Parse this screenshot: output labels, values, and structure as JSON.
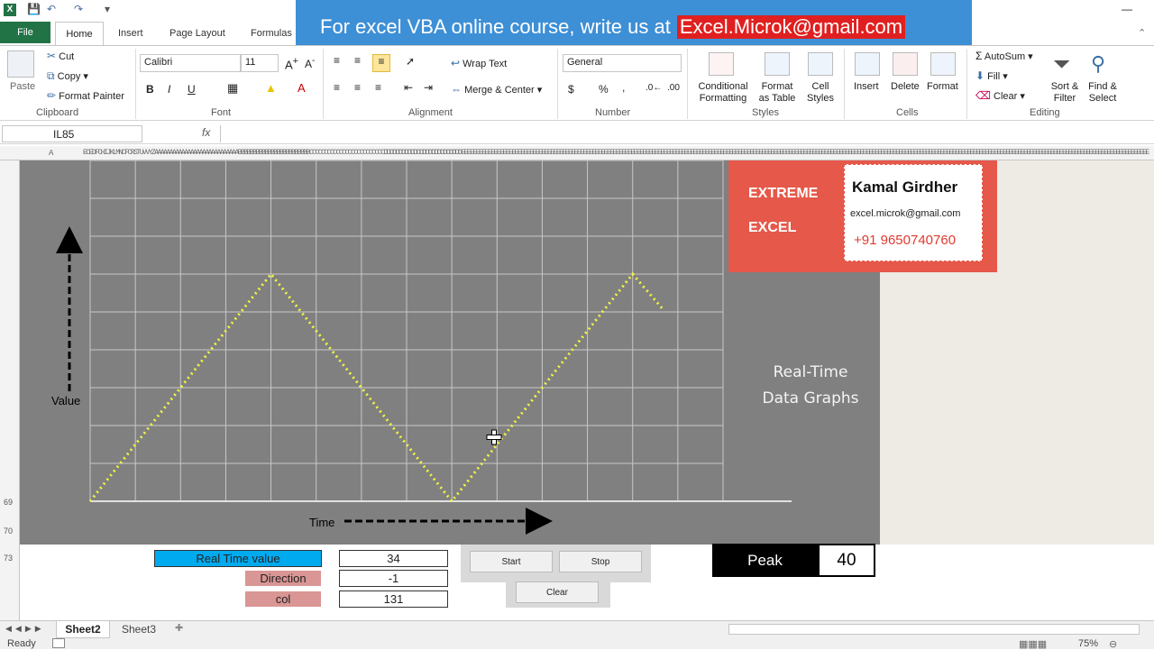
{
  "window": {
    "minimize_glyph": "—"
  },
  "banner": {
    "prefix": "For excel VBA online course, write us at",
    "email": "Excel.Microk@gmail.com"
  },
  "tabs": {
    "file": "File",
    "home": "Home",
    "insert": "Insert",
    "page_layout": "Page Layout",
    "formulas": "Formulas"
  },
  "ribbon": {
    "clipboard": {
      "group": "Clipboard",
      "paste": "Paste",
      "cut": "Cut",
      "copy": "Copy",
      "format_painter": "Format Painter"
    },
    "font": {
      "group": "Font",
      "name": "Calibri",
      "size": "11",
      "bold": "B",
      "italic": "I",
      "underline": "U"
    },
    "alignment": {
      "group": "Alignment",
      "wrap_text": "Wrap Text",
      "merge_center": "Merge & Center"
    },
    "number": {
      "group": "Number",
      "format": "General",
      "currency": "$",
      "percent": "%",
      "comma": ","
    },
    "styles": {
      "group": "Styles",
      "conditional": "Conditional Formatting",
      "format_table": "Format as Table",
      "cell_styles": "Cell Styles"
    },
    "cells": {
      "group": "Cells",
      "insert": "Insert",
      "delete": "Delete",
      "format": "Format"
    },
    "editing": {
      "group": "Editing",
      "autosum": "AutoSum",
      "fill": "Fill",
      "clear": "Clear",
      "sort_filter": "Sort & Filter",
      "find_select": "Find & Select"
    }
  },
  "formula_bar": {
    "name_box": "IL85",
    "fx": "fx",
    "content": ""
  },
  "col_header": {
    "first": "A",
    "letters": "ECEDFCHIJKLMNCFCRSTUVVYZAAAAAAAAAAAAAAAAAAAAAAAAAAAABBBBBBBBBBBBBBBBBBBBBBBBCCCCCCCCCCCCCCCCCCCCCCCCCDDDDDDDDDDDDDDDDDDDDDDDDDDEEEEEEEEEEEEEEEEEEEEEEEEEEEEEEEEEEEEEEEEEEEEEEEEEEEEEEEEEEEEEEEEEEEEEEEEEEEEEEEEEEEEEEEEEEEEEEEEEEEEEEEEEEEEEEEEEEEEEEEEEEEEEEEEEEEEEEEEEEEEEEEEEEEEEEEEEEEEEEEEEEEEEEEEEEEEEEEEEEEEEEEEEEEEEEEEEEEEEEEEEEEEEEEEEEEEEEEEEEEEEEEEEEEEEEE"
  },
  "rows": {
    "r69": "69",
    "r70": "70",
    "r73": "73"
  },
  "graph": {
    "value_label": "Value",
    "time_label": "Time",
    "caption_line1": "Real-Time",
    "caption_line2": "Data Graphs"
  },
  "logo": {
    "line1": "EXTREME",
    "line2": "EXCEL",
    "name": "Kamal Girdher",
    "email": "excel.microk@gmail.com",
    "phone": "+91 9650740760"
  },
  "controls": {
    "real_time_label": "Real Time value",
    "real_time_value": "34",
    "direction_label": "Direction",
    "direction_value": "-1",
    "col_label": "col",
    "col_value": "131",
    "start": "Start",
    "stop": "Stop",
    "clear": "Clear",
    "peak_label": "Peak",
    "peak_value": "40"
  },
  "sheets": {
    "tab1": "Sheet2",
    "tab2": "Sheet3"
  },
  "status": {
    "ready": "Ready",
    "zoom": "75%"
  },
  "colors": {
    "line": "#f2f542",
    "grid": "#c8c8c8",
    "graph_bg": "#808080",
    "accent": "#217346"
  },
  "chart_data": {
    "type": "line",
    "x": [
      0,
      40,
      80,
      120,
      160,
      200,
      240,
      253
    ],
    "y": [
      0,
      20,
      40,
      20,
      0,
      20,
      40,
      34
    ],
    "xlim": [
      0,
      280
    ],
    "ylim": [
      0,
      60
    ],
    "xlabel": "Time",
    "ylabel": "Value",
    "grid": true
  }
}
